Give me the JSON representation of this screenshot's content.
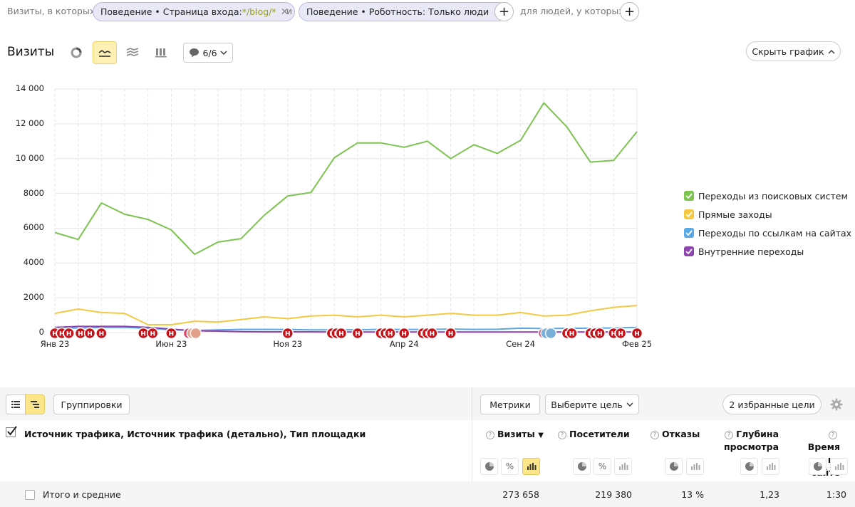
{
  "filters": {
    "prefix": "Визиты, в которых",
    "chip1": {
      "label": "Поведение • Страница входа: ",
      "value": "*/blog/*"
    },
    "conj": "и",
    "chip2": {
      "label": "Поведение • Роботность: Только люди"
    },
    "suffix": "для людей, у которых",
    "plus_icon": "+"
  },
  "report": {
    "title": "Визиты",
    "annotations_count": "6/6",
    "hide_chart_label": "Скрыть график"
  },
  "chart_data": {
    "type": "line",
    "x": [
      "Янв 23",
      "Фев 23",
      "Мар 23",
      "Апр 23",
      "Май 23",
      "Июн 23",
      "Июл 23",
      "Авг 23",
      "Сен 23",
      "Окт 23",
      "Ноя 23",
      "Дек 23",
      "Янв 24",
      "Фев 24",
      "Мар 24",
      "Апр 24",
      "Май 24",
      "Июн 24",
      "Июл 24",
      "Авг 24",
      "Сен 24",
      "Окт 24",
      "Ноя 24",
      "Дек 24",
      "Янв 25",
      "Фев 25"
    ],
    "x_tick_labels": [
      "Янв 23",
      "Июн 23",
      "Ноя 23",
      "Апр 24",
      "Сен 24",
      "Фев 25"
    ],
    "ylim": [
      0,
      14000
    ],
    "y_ticks": [
      "0",
      "2000",
      "4000",
      "6000",
      "8000",
      "10 000",
      "12 000",
      "14 000"
    ],
    "grid": true,
    "legend_position": "right",
    "series": [
      {
        "name": "Переходы из поисковых систем",
        "color": "#7cc44f",
        "values": [
          5750,
          5350,
          7450,
          6800,
          6500,
          5900,
          4500,
          5200,
          5400,
          6750,
          7850,
          8050,
          10050,
          10900,
          10900,
          10650,
          11000,
          10000,
          10800,
          10300,
          11050,
          13200,
          11800,
          9800,
          9900,
          11550
        ]
      },
      {
        "name": "Прямые заходы",
        "color": "#f5c842",
        "values": [
          1100,
          1350,
          1150,
          1100,
          450,
          450,
          650,
          600,
          750,
          900,
          800,
          950,
          1000,
          900,
          1000,
          900,
          1000,
          1100,
          1000,
          1000,
          1150,
          950,
          1000,
          1250,
          1450,
          1550
        ]
      },
      {
        "name": "Переходы по ссылкам на сайтах",
        "color": "#5aa9e6",
        "values": [
          300,
          250,
          300,
          300,
          250,
          150,
          120,
          150,
          180,
          180,
          170,
          150,
          150,
          160,
          180,
          170,
          180,
          200,
          180,
          190,
          250,
          230,
          240,
          250,
          260,
          300
        ]
      },
      {
        "name": "Внутренние переходы",
        "color": "#8e44ad",
        "values": [
          300,
          350,
          350,
          350,
          300,
          200,
          100,
          80,
          50,
          40,
          40,
          40,
          30,
          30,
          30,
          30,
          30,
          30,
          30,
          30,
          30,
          30,
          30,
          30,
          30,
          30
        ]
      }
    ],
    "annotation_markers": [
      "Н",
      "А"
    ]
  },
  "table": {
    "groupings_label": "Группировки",
    "metrics_label": "Метрики",
    "goal_label": "Выберите цель",
    "fav_goals_label": "2 избранные цели",
    "dimension_header": "Источник трафика, Источник трафика (детально), Тип площадки",
    "columns": [
      {
        "label": "Визиты",
        "sorted": "▼"
      },
      {
        "label": "Посетители"
      },
      {
        "label": "Отказы"
      },
      {
        "label": "Глубина просмотра"
      },
      {
        "label": "Время на сайте"
      }
    ],
    "totals_row": {
      "label": "Итого и средние",
      "values": [
        "273 658",
        "219 380",
        "13 %",
        "1,23",
        "1:30"
      ]
    },
    "percent_icon": "%",
    "question_icon": "?"
  }
}
